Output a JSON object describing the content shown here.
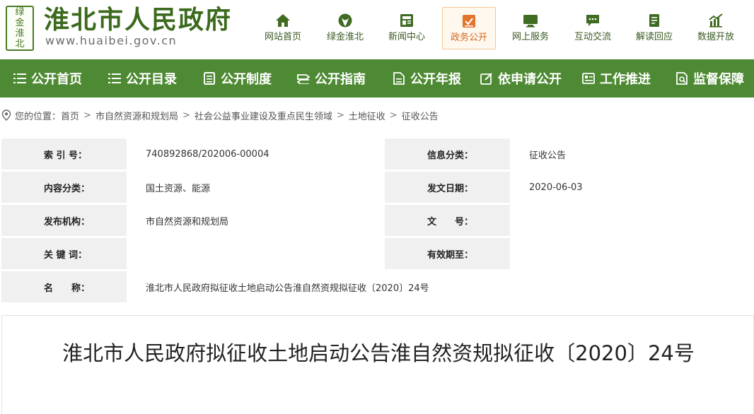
{
  "site": {
    "logo_text": [
      "绿",
      "金",
      "淮",
      "北"
    ],
    "title": "淮北市人民政府",
    "url": "www.huaibei.gov.cn"
  },
  "topnav": [
    {
      "label": "网站首页",
      "icon": "home-icon"
    },
    {
      "label": "绿金淮北",
      "icon": "leaf-globe-icon"
    },
    {
      "label": "新闻中心",
      "icon": "news-icon"
    },
    {
      "label": "政务公开",
      "icon": "gov-open-icon",
      "active": true
    },
    {
      "label": "网上服务",
      "icon": "monitor-icon"
    },
    {
      "label": "互动交流",
      "icon": "chat-icon"
    },
    {
      "label": "解读回应",
      "icon": "book-icon"
    },
    {
      "label": "数据开放",
      "icon": "chart-icon"
    }
  ],
  "mainnav": [
    {
      "label": "公开首页",
      "icon": "list-icon"
    },
    {
      "label": "公开目录",
      "icon": "list-icon"
    },
    {
      "label": "公开制度",
      "icon": "document-icon"
    },
    {
      "label": "公开指南",
      "icon": "guide-icon"
    },
    {
      "label": "公开年报",
      "icon": "report-icon"
    },
    {
      "label": "依申请公开",
      "icon": "edit-icon"
    },
    {
      "label": "工作推进",
      "icon": "progress-icon"
    },
    {
      "label": "监督保障",
      "icon": "supervise-icon"
    }
  ],
  "breadcrumb": {
    "prefix": "您的位置：",
    "items": [
      "首页",
      "市自然资源和规划局",
      "社会公益事业建设及重点民生领域",
      "土地征收",
      "征收公告"
    ],
    "separator": ">"
  },
  "info": {
    "index_label": "索 引 号：",
    "index_value": "740892868/202006-00004",
    "category_label": "信息分类：",
    "category_value": "征收公告",
    "content_label": "内容分类：",
    "content_value": "国土资源、能源",
    "date_label": "发文日期：",
    "date_value": "2020-06-03",
    "publisher_label": "发布机构：",
    "publisher_value": "市自然资源和规划局",
    "docno_label": "文　　号：",
    "docno_value": "",
    "keywords_label": "关 键 词：",
    "keywords_value": "",
    "validity_label": "有效期至：",
    "validity_value": "",
    "name_label": "名　　称：",
    "name_value": "淮北市人民政府拟征收土地启动公告淮自然资规拟征收〔2020〕24号"
  },
  "article": {
    "title": "淮北市人民政府拟征收土地启动公告淮自然资规拟征收〔2020〕24号"
  },
  "colors": {
    "brand_green": "#4e8a33",
    "logo_green": "#3b6a1d",
    "active_orange": "#d6661e",
    "label_bg": "#f0f0f0"
  }
}
